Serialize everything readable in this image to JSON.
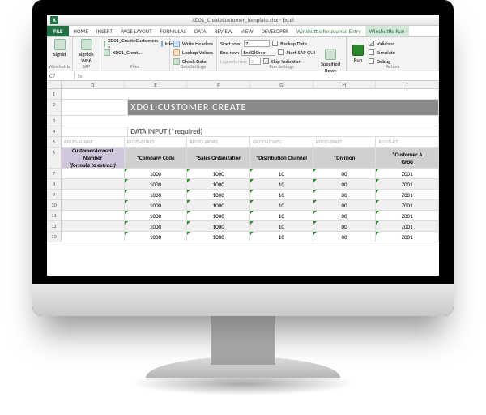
{
  "titlebar": {
    "app_badge": "X",
    "title": "XD01_CreateCustomer_template.xlsx - Excel"
  },
  "tabs": {
    "file": "FILE",
    "items": [
      "HOME",
      "INSERT",
      "PAGE LAYOUT",
      "FORMULAS",
      "DATA",
      "REVIEW",
      "VIEW",
      "DEVELOPER",
      "Winshuttle for Journal Entry",
      "Winshuttle Run"
    ]
  },
  "ribbon": {
    "winshuttle": {
      "label": "Winshuttle",
      "btn": "Signid"
    },
    "sap": {
      "label": "SAP",
      "btn": "signidk\nWE6"
    },
    "files": {
      "label": "Files",
      "items": [
        "XD01_CreateCustomers ×",
        "XD01_Creat…"
      ],
      "info": "Info"
    },
    "data_settings": {
      "label": "Data Settings",
      "items": [
        "Write Headers",
        "Lookup Values",
        "Check Data"
      ]
    },
    "run_settings": {
      "label": "Run Settings",
      "start_row_label": "Start row:",
      "start_row": "7",
      "end_row_label": "End row:",
      "end_row": "EndOfSheet",
      "log_cols_label": "Log columns",
      "log_cols": "2",
      "chk": [
        "Backup Data",
        "Start SAP GUI",
        "Skip Indicator"
      ],
      "specified": "Specified\nRows"
    },
    "actions": {
      "label": "Action",
      "run": "Run",
      "items": [
        "Validate",
        "Simulate",
        "Debug"
      ]
    }
  },
  "formula_bar": {
    "namebox": "C7",
    "fx": "fx",
    "value": ""
  },
  "columns": [
    "D",
    "E",
    "F",
    "G",
    "H",
    "I"
  ],
  "sheet": {
    "banner": "XD01 CUSTOMER CREATE",
    "section": "DATA INPUT (*required)",
    "tech_row": [
      "RF02D-KUNNR",
      "RF02D-BUKRS",
      "RF02D-VKORG",
      "RF02D-VTWEG",
      "RF02D-SPART",
      "RF02D-KT"
    ],
    "headers": [
      "CustomerAccount\nNumber\n(formula to extract)",
      "*Company Code",
      "*Sales Organization",
      "*Distribution Channel",
      "*Division",
      "*Customer A\nGrou"
    ],
    "rows": [
      {
        "n": "7",
        "v": [
          "",
          "1000",
          "1000",
          "10",
          "00",
          "Z001"
        ]
      },
      {
        "n": "8",
        "v": [
          "",
          "1000",
          "1000",
          "10",
          "00",
          "Z001"
        ]
      },
      {
        "n": "9",
        "v": [
          "",
          "1000",
          "1000",
          "10",
          "00",
          "Z001"
        ]
      },
      {
        "n": "10",
        "v": [
          "",
          "1000",
          "1000",
          "10",
          "00",
          "Z001"
        ]
      },
      {
        "n": "11",
        "v": [
          "",
          "1000",
          "1000",
          "10",
          "00",
          "Z001"
        ]
      },
      {
        "n": "12",
        "v": [
          "",
          "1000",
          "1000",
          "10",
          "00",
          "Z001"
        ]
      },
      {
        "n": "13",
        "v": [
          "",
          "1000",
          "1000",
          "10",
          "00",
          "Z001"
        ]
      }
    ]
  }
}
